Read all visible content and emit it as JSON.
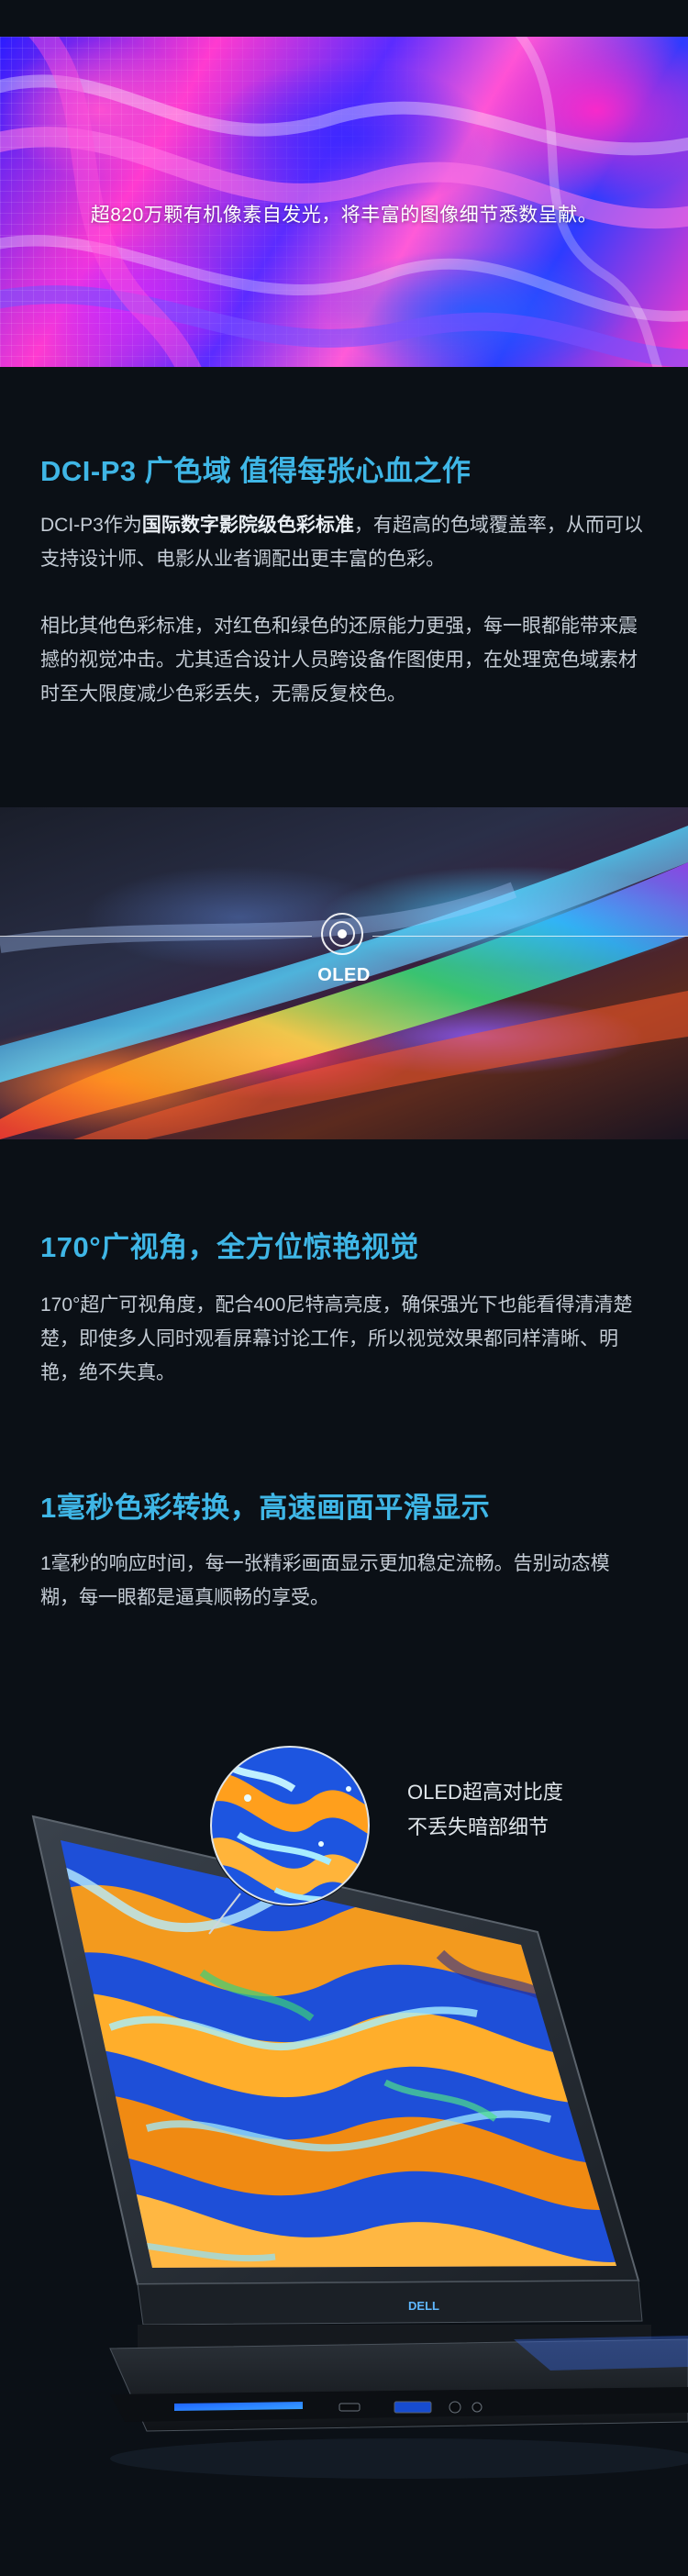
{
  "hero": {
    "caption": "超820万颗有机像素自发光，将丰富的图像细节悉数呈献。"
  },
  "section_dci": {
    "title": "DCI-P3 广色域 值得每张心血之作",
    "para1_prefix": "DCI-P3作为",
    "para1_bold": "国际数字影院级色彩标准",
    "para1_suffix": "，有超高的色域覆盖率，从而可以支持设计师、电影从业者调配出更丰富的色彩。",
    "para2": "相比其他色彩标准，对红色和绿色的还原能力更强，每一眼都能带来震撼的视觉冲击。尤其适合设计人员跨设备作图使用，在处理宽色域素材时至大限度减少色彩丢失，无需反复校色。"
  },
  "oled_band": {
    "label": "OLED"
  },
  "section_angle": {
    "title": "170°广视角，全方位惊艳视觉",
    "para": "170°超广可视角度，配合400尼特高亮度，确保强光下也能看得清清楚楚，即使多人同时观看屏幕讨论工作，所以视觉效果都同样清晰、明艳，绝不失真。"
  },
  "section_response": {
    "title": "1毫秒色彩转换，高速画面平滑显示",
    "para": "1毫秒的响应时间，每一张精彩画面显示更加稳定流畅。告别动态模糊，每一眼都是逼真顺畅的享受。"
  },
  "laptop": {
    "zoom_note_line1": "OLED超高对比度",
    "zoom_note_line2": "不丢失暗部细节",
    "logo": "DELL"
  },
  "colors": {
    "background": "#0b1016",
    "accent": "#3fb6e6",
    "body_text": "#c4ccd5"
  }
}
